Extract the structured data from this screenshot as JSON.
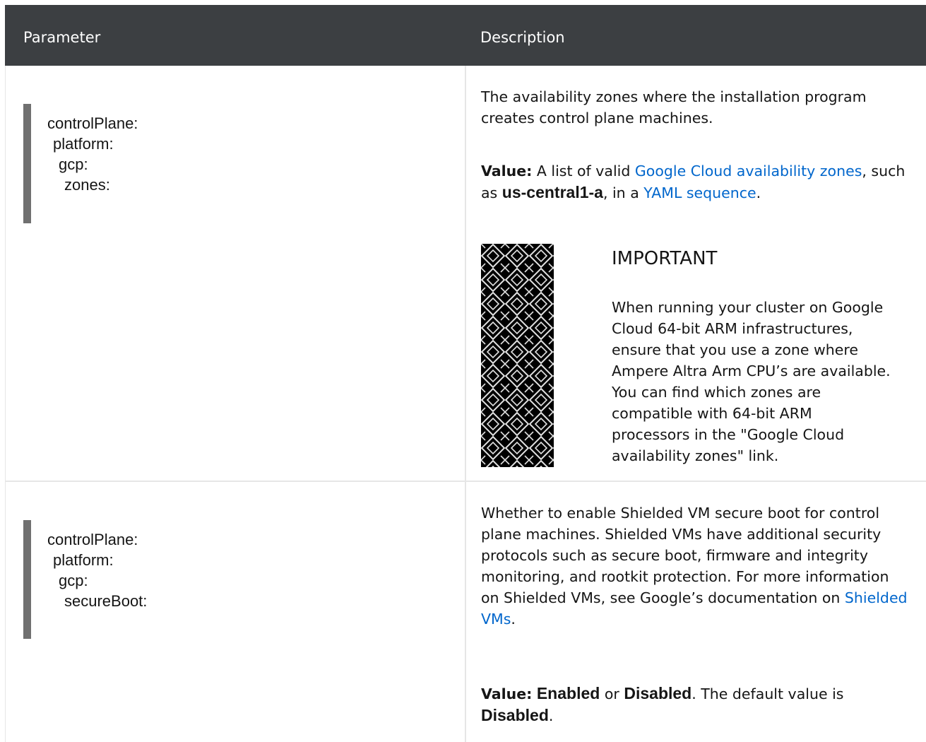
{
  "header": {
    "parameter": "Parameter",
    "description": "Description"
  },
  "rows": [
    {
      "code": [
        "controlPlane:",
        "platform:",
        "gcp:",
        "zones:"
      ],
      "desc_text": "The availability zones where the installation program creates control plane machines.",
      "value_label": "Value:",
      "value_pre": "A list of valid",
      "value_link1": "Google Cloud availability zones",
      "value_mid1": ", such as",
      "value_code": "us-central1-a",
      "value_mid2": ", in a",
      "value_link2": "YAML sequence",
      "value_end": ".",
      "important": {
        "title": "IMPORTANT",
        "text": "When running your cluster on Google Cloud 64-bit ARM infrastructures, ensure that you use a zone where Ampere Altra Arm CPU’s are available. You can find which zones are compatible with 64-bit ARM processors in the \"Google Cloud availability zones\" link."
      }
    },
    {
      "code": [
        "controlPlane:",
        "platform:",
        "gcp:",
        "secureBoot:"
      ],
      "desc_text": "Whether to enable Shielded VM secure boot for control plane machines. Shielded VMs have additional security protocols such as secure boot, firmware and integrity monitoring, and rootkit protection. For more information on Shielded VMs, see Google’s documentation on",
      "desc_link": "Shielded VMs",
      "desc_end": ".",
      "value_label": "Value:",
      "value_opt1": "Enabled",
      "value_or": "or",
      "value_opt2": "Disabled",
      "value_mid": ". The default value is",
      "value_default": "Disabled",
      "value_end": "."
    }
  ]
}
